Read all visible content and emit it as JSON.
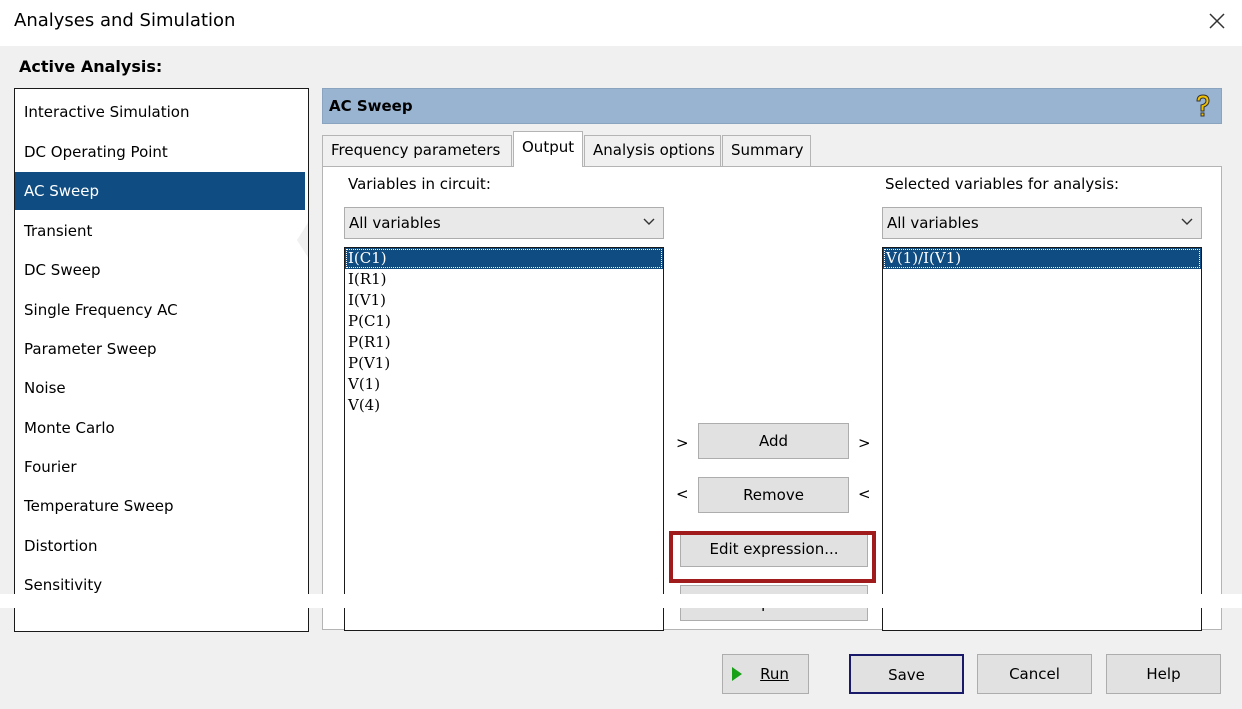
{
  "window": {
    "title": "Analyses and Simulation",
    "close_icon": "close-icon"
  },
  "active_analysis_label": "Active Analysis:",
  "analyses": [
    {
      "label": "Interactive Simulation",
      "selected": false
    },
    {
      "label": "DC Operating Point",
      "selected": false
    },
    {
      "label": "AC Sweep",
      "selected": true
    },
    {
      "label": "Transient",
      "selected": false
    },
    {
      "label": "DC Sweep",
      "selected": false
    },
    {
      "label": "Single Frequency AC",
      "selected": false
    },
    {
      "label": "Parameter Sweep",
      "selected": false
    },
    {
      "label": "Noise",
      "selected": false
    },
    {
      "label": "Monte Carlo",
      "selected": false
    },
    {
      "label": "Fourier",
      "selected": false
    },
    {
      "label": "Temperature Sweep",
      "selected": false
    },
    {
      "label": "Distortion",
      "selected": false
    },
    {
      "label": "Sensitivity",
      "selected": false
    }
  ],
  "panel": {
    "title": "AC Sweep",
    "help_icon": "help-icon"
  },
  "tabs": [
    {
      "label": "Frequency parameters",
      "active": false
    },
    {
      "label": "Output",
      "active": true
    },
    {
      "label": "Analysis options",
      "active": false
    },
    {
      "label": "Summary",
      "active": false
    }
  ],
  "output": {
    "variables_label": "Variables in circuit:",
    "variables_filter": "All variables",
    "variables": [
      "I(C1)",
      "I(R1)",
      "I(V1)",
      "P(C1)",
      "P(R1)",
      "P(V1)",
      "V(1)",
      "V(4)"
    ],
    "variables_selected_index": 0,
    "selected_label": "Selected variables for analysis:",
    "selected_filter": "All variables",
    "selected_variables": [
      "V(1)/I(V1)"
    ],
    "add_arrow_left": ">",
    "add_button": "Add",
    "add_arrow_right": ">",
    "remove_arrow_left": "<",
    "remove_button": "Remove",
    "remove_arrow_right": "<",
    "edit_expression_button": "Edit expression...",
    "add_expression_button": "Add expression..."
  },
  "footer": {
    "run_button": "Run",
    "save_button": "Save",
    "cancel_button": "Cancel",
    "help_button": "Help"
  },
  "colors": {
    "selection": "#0f4c81",
    "header": "#99b4d1",
    "highlight": "#a01c1c",
    "run_icon": "#18a018"
  }
}
